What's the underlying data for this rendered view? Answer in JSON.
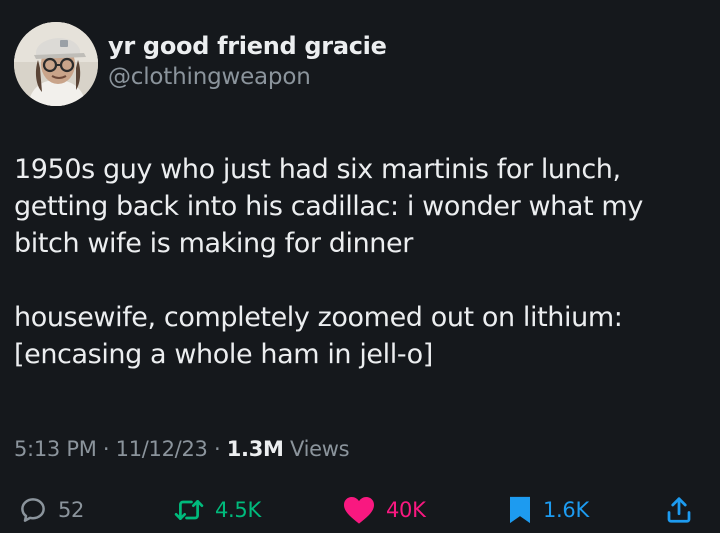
{
  "user": {
    "display_name": "yr good friend gracie",
    "handle": "@clothingweapon"
  },
  "tweet": {
    "paragraph_1": "1950s guy who just had six martinis for lunch, getting back into his cadillac: i wonder what my bitch wife is making for dinner",
    "paragraph_2": "housewife, completely zoomed out on lithium: [encasing a whole ham in jell-o]"
  },
  "meta": {
    "time": "5:13 PM",
    "separator": " · ",
    "date": "11/12/23",
    "views_count": "1.3M",
    "views_label": " Views"
  },
  "actions": {
    "replies": "52",
    "reposts": "4.5K",
    "likes": "40K",
    "bookmarks": "1.6K"
  },
  "colors": {
    "background": "#15181c",
    "reply": "#8b949c",
    "repost": "#00ba7c",
    "like": "#f91880",
    "bookmark": "#1d9bf0",
    "share": "#1d9bf0"
  },
  "icons": {
    "reply": "speech-bubble-icon",
    "repost": "repost-arrows-icon",
    "like": "heart-icon",
    "bookmark": "bookmark-icon",
    "share": "share-icon"
  }
}
